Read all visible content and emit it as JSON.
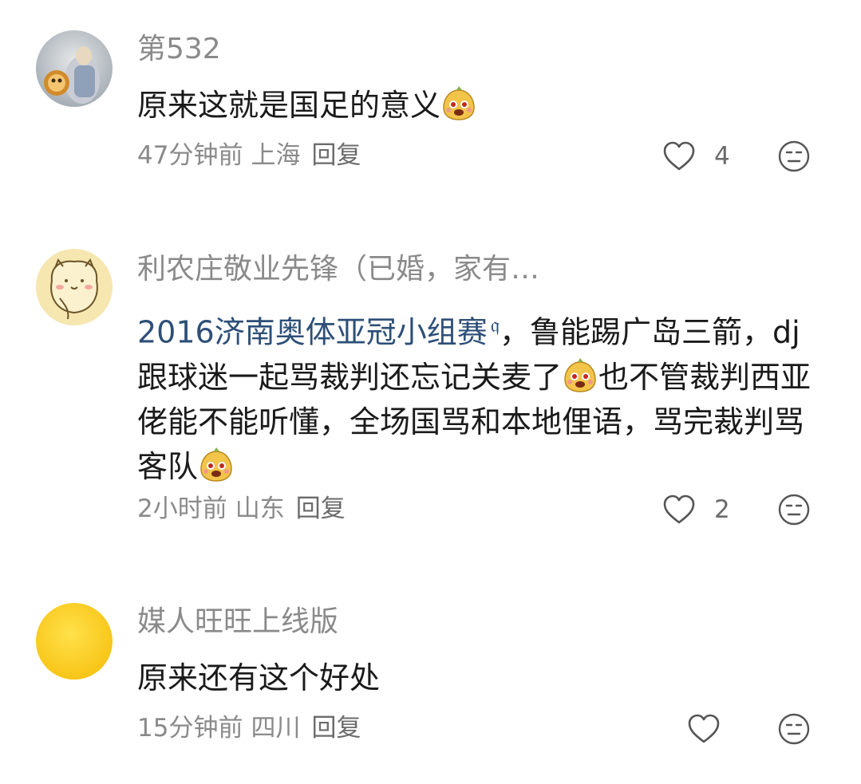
{
  "comments": [
    {
      "username": "第532",
      "text": "原来这就是国足的意义",
      "time": "47分钟前",
      "location": "上海",
      "reply": "回复",
      "likes": "4"
    },
    {
      "username": "利农庄敬业先锋（已婚，家有…",
      "topic": "2016济南奥体亚冠小组赛",
      "text_a": "，鲁能踢广岛三箭，dj跟球迷一起骂裁判还忘记关麦了",
      "text_b": "也不管裁判西亚佬能不能听懂，全场国骂和本地俚语，骂完裁判骂客队",
      "time": "2小时前",
      "location": "山东",
      "reply": "回复",
      "likes": "2"
    },
    {
      "username": "媒人旺旺上线版",
      "text": "原来还有这个好处",
      "time": "15分钟前",
      "location": "四川",
      "reply": "回复",
      "likes": ""
    }
  ],
  "icons": {
    "like": "heart-outline-icon",
    "reaction": "neutral-face-icon",
    "emoji": "yellow-blob-emoji"
  },
  "colors": {
    "username": "#8a8a8a",
    "text": "#1a1a1a",
    "topic_link": "#2d4f78",
    "icon": "#555555"
  }
}
